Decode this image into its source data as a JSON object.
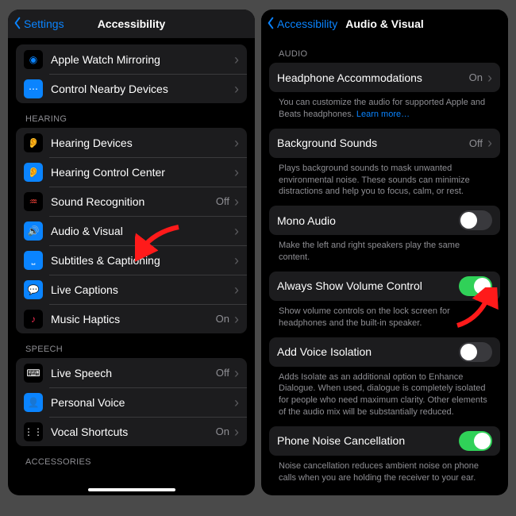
{
  "left": {
    "nav": {
      "back": "Settings",
      "title": "Accessibility"
    },
    "group_top": [
      {
        "id": "apple-watch-mirroring",
        "label": "Apple Watch Mirroring",
        "iconBg": "#000",
        "iconFg": "#0a84ff",
        "glyph": "◉"
      },
      {
        "id": "control-nearby",
        "label": "Control Nearby Devices",
        "iconBg": "#0a84ff",
        "iconFg": "#fff",
        "glyph": "⋯"
      }
    ],
    "section_hearing": "HEARING",
    "group_hearing": [
      {
        "id": "hearing-devices",
        "label": "Hearing Devices",
        "iconBg": "#000",
        "iconFg": "#0a84ff",
        "glyph": "👂"
      },
      {
        "id": "hearing-control",
        "label": "Hearing Control Center",
        "iconBg": "#0a84ff",
        "iconFg": "#fff",
        "glyph": "👂"
      },
      {
        "id": "sound-recognition",
        "label": "Sound Recognition",
        "value": "Off",
        "iconBg": "#000",
        "iconFg": "#ff453a",
        "glyph": "♒︎"
      },
      {
        "id": "audio-visual",
        "label": "Audio & Visual",
        "iconBg": "#0a84ff",
        "iconFg": "#fff",
        "glyph": "🔊"
      },
      {
        "id": "subtitles",
        "label": "Subtitles & Captioning",
        "iconBg": "#0a84ff",
        "iconFg": "#fff",
        "glyph": "⎵"
      },
      {
        "id": "live-captions",
        "label": "Live Captions",
        "iconBg": "#0a84ff",
        "iconFg": "#fff",
        "glyph": "💬"
      },
      {
        "id": "music-haptics",
        "label": "Music Haptics",
        "value": "On",
        "iconBg": "#000",
        "iconFg": "#ff2d55",
        "glyph": "♪"
      }
    ],
    "section_speech": "SPEECH",
    "group_speech": [
      {
        "id": "live-speech",
        "label": "Live Speech",
        "value": "Off",
        "iconBg": "#000",
        "iconFg": "#fff",
        "glyph": "⌨︎"
      },
      {
        "id": "personal-voice",
        "label": "Personal Voice",
        "iconBg": "#0a84ff",
        "iconFg": "#fff",
        "glyph": "👤"
      },
      {
        "id": "vocal-shortcuts",
        "label": "Vocal Shortcuts",
        "value": "On",
        "iconBg": "#000",
        "iconFg": "#fff",
        "glyph": "⋮⋮"
      }
    ],
    "section_accessories": "ACCESSORIES"
  },
  "right": {
    "nav": {
      "back": "Accessibility",
      "title": "Audio & Visual"
    },
    "section_audio": "AUDIO",
    "headphone": {
      "label": "Headphone Accommodations",
      "value": "On"
    },
    "headphone_footer_a": "You can customize the audio for supported Apple and Beats headphones. ",
    "headphone_footer_link": "Learn more…",
    "background": {
      "label": "Background Sounds",
      "value": "Off"
    },
    "background_footer": "Plays background sounds to mask unwanted environmental noise. These sounds can minimize distractions and help you to focus, calm, or rest.",
    "mono": {
      "label": "Mono Audio",
      "on": false
    },
    "mono_footer": "Make the left and right speakers play the same content.",
    "volume": {
      "label": "Always Show Volume Control",
      "on": true
    },
    "volume_footer": "Show volume controls on the lock screen for headphones and the built-in speaker.",
    "voice_iso": {
      "label": "Add Voice Isolation",
      "on": false
    },
    "voice_iso_footer": "Adds Isolate as an additional option to Enhance Dialogue. When used, dialogue is completely isolated for people who need maximum clarity. Other elements of the audio mix will be substantially reduced.",
    "noise": {
      "label": "Phone Noise Cancellation",
      "on": true
    },
    "noise_footer": "Noise cancellation reduces ambient noise on phone calls when you are holding the receiver to your ear."
  }
}
